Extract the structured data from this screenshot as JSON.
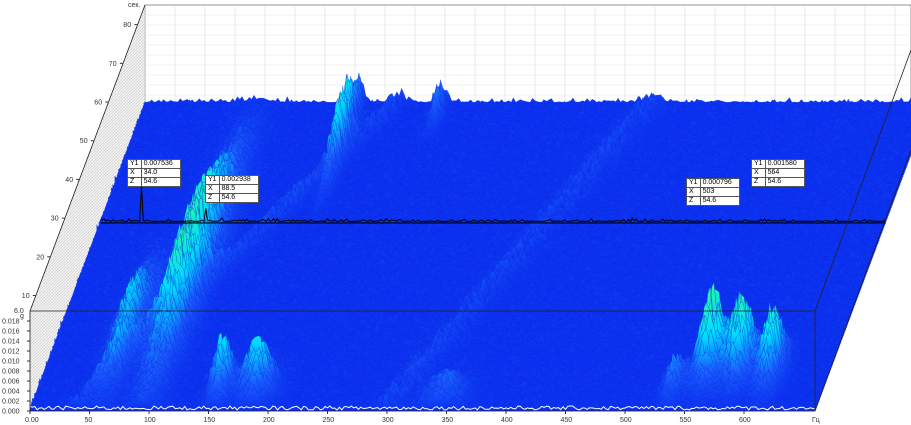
{
  "chart_data": {
    "type": "waterfall-3d",
    "x_axis": {
      "unit_label": "Гц",
      "range": [
        0,
        660
      ],
      "tick_labels": [
        "0.00",
        "50",
        "100",
        "150",
        "200",
        "250",
        "300",
        "350",
        "400",
        "450",
        "500",
        "550",
        "600"
      ]
    },
    "y_axis": {
      "unit_label": "g",
      "range": [
        0,
        0.02
      ],
      "tick_labels": [
        "0.000",
        "0.002",
        "0.004",
        "0.006",
        "0.008",
        "0.010",
        "0.012",
        "0.014",
        "0.016",
        "0.018"
      ]
    },
    "z_axis": {
      "unit_label": "сек.",
      "start_label": "6.0",
      "range": [
        6,
        85
      ],
      "tick_labels": [
        "10",
        "20",
        "30",
        "40",
        "50",
        "60",
        "70",
        "80"
      ]
    },
    "highlighted_slice_z": 54.6,
    "cursors": [
      {
        "Y1": "0.007536",
        "X": "34.0",
        "Z": "54.6"
      },
      {
        "Y1": "0.002938",
        "X": "88.5",
        "Z": "54.6"
      },
      {
        "Y1": "0.000796",
        "X": "503",
        "Z": "54.6"
      },
      {
        "Y1": "0.001580",
        "X": "564",
        "Z": "54.6"
      }
    ],
    "peak_features": [
      {
        "f": 95,
        "z": 40,
        "amp": 0.016,
        "wf": 10,
        "wz": 18
      },
      {
        "f": 60,
        "z": 25,
        "amp": 0.01,
        "wf": 8,
        "wz": 10
      },
      {
        "f": 155,
        "z": 11,
        "amp": 0.012,
        "wf": 6,
        "wz": 3
      },
      {
        "f": 185,
        "z": 11,
        "amp": 0.011,
        "wf": 10,
        "wz": 3
      },
      {
        "f": 345,
        "z": 9,
        "amp": 0.005,
        "wf": 12,
        "wz": 3
      },
      {
        "f": 560,
        "z": 16,
        "amp": 0.018,
        "wf": 8,
        "wz": 4
      },
      {
        "f": 585,
        "z": 16,
        "amp": 0.016,
        "wf": 8,
        "wz": 4
      },
      {
        "f": 612,
        "z": 15,
        "amp": 0.015,
        "wf": 7,
        "wz": 4
      },
      {
        "f": 535,
        "z": 11,
        "amp": 0.007,
        "wf": 6,
        "wz": 3
      },
      {
        "f": 250,
        "z": 82,
        "amp": 0.006,
        "wf": 4,
        "wz": 3
      },
      {
        "f": 180,
        "z": 75,
        "amp": 0.012,
        "wf": 4,
        "wz": 8
      }
    ],
    "colors": {
      "low": "#0a2cf0",
      "mid": "#00dcff",
      "high": "#30ff90",
      "slice": "#000000"
    }
  }
}
